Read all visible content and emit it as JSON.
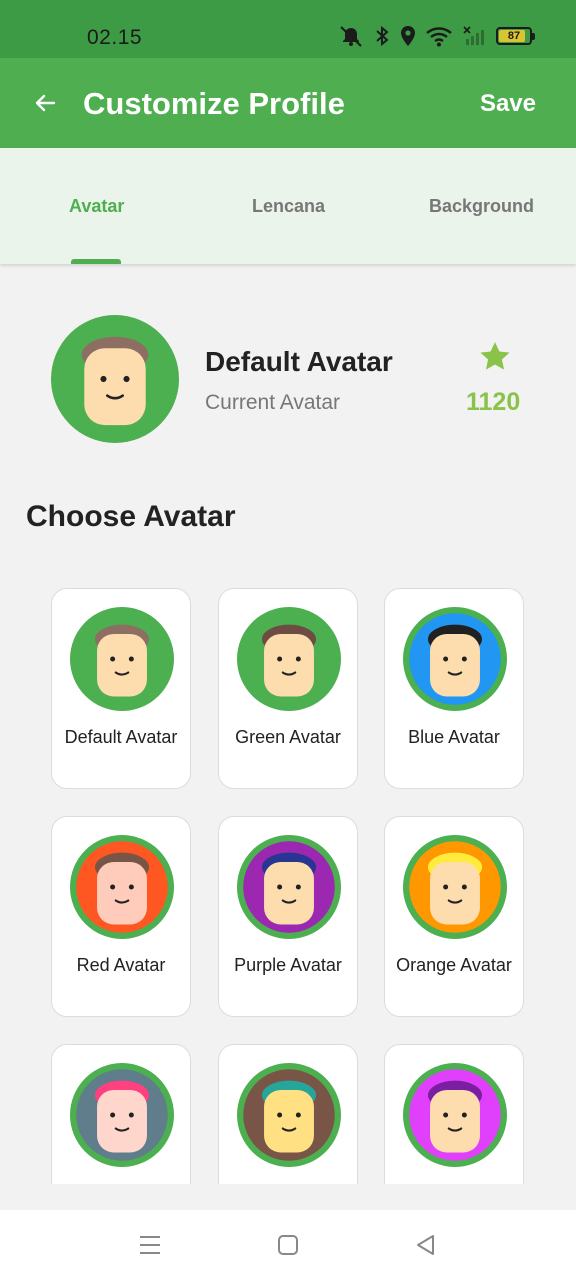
{
  "status": {
    "time": "02.15",
    "battery": "87",
    "battery_level": 0.87
  },
  "header": {
    "title": "Customize Profile",
    "save_label": "Save"
  },
  "tabs": [
    {
      "label": "Avatar",
      "active": true
    },
    {
      "label": "Lencana",
      "active": false
    },
    {
      "label": "Background",
      "active": false
    }
  ],
  "current": {
    "name": "Default Avatar",
    "subtitle": "Current Avatar",
    "points": "1120"
  },
  "section_title": "Choose Avatar",
  "avatars": [
    {
      "label": "Default Avatar",
      "bg": "#4caf50",
      "ring": "#4caf50",
      "skin": "#fddcae",
      "hair": "#8d6e63"
    },
    {
      "label": "Green Avatar",
      "bg": "#4caf50",
      "ring": "#4caf50",
      "skin": "#fddcae",
      "hair": "#6d4c41"
    },
    {
      "label": "Blue Avatar",
      "bg": "#2196f3",
      "ring": "#4caf50",
      "skin": "#fddcae",
      "hair": "#212121"
    },
    {
      "label": "Red Avatar",
      "bg": "#ff5722",
      "ring": "#4caf50",
      "skin": "#ffccbc",
      "hair": "#795548"
    },
    {
      "label": "Purple Avatar",
      "bg": "#9c27b0",
      "ring": "#4caf50",
      "skin": "#fddcae",
      "hair": "#283593"
    },
    {
      "label": "Orange Avatar",
      "bg": "#ff9800",
      "ring": "#4caf50",
      "skin": "#fddcae",
      "hair": "#ffeb3b"
    },
    {
      "label": "",
      "bg": "#607d8b",
      "ring": "#4caf50",
      "skin": "#ffd6cc",
      "hair": "#ff4081"
    },
    {
      "label": "",
      "bg": "#795548",
      "ring": "#4caf50",
      "skin": "#ffe082",
      "hair": "#26a69a"
    },
    {
      "label": "",
      "bg": "#e040fb",
      "ring": "#4caf50",
      "skin": "#fddcae",
      "hair": "#7b1fa2"
    }
  ],
  "colors": {
    "primary": "#4fae50",
    "status_bar": "#3d9a45",
    "points": "#8bc34a",
    "tab_bg": "#eaf4ea"
  }
}
